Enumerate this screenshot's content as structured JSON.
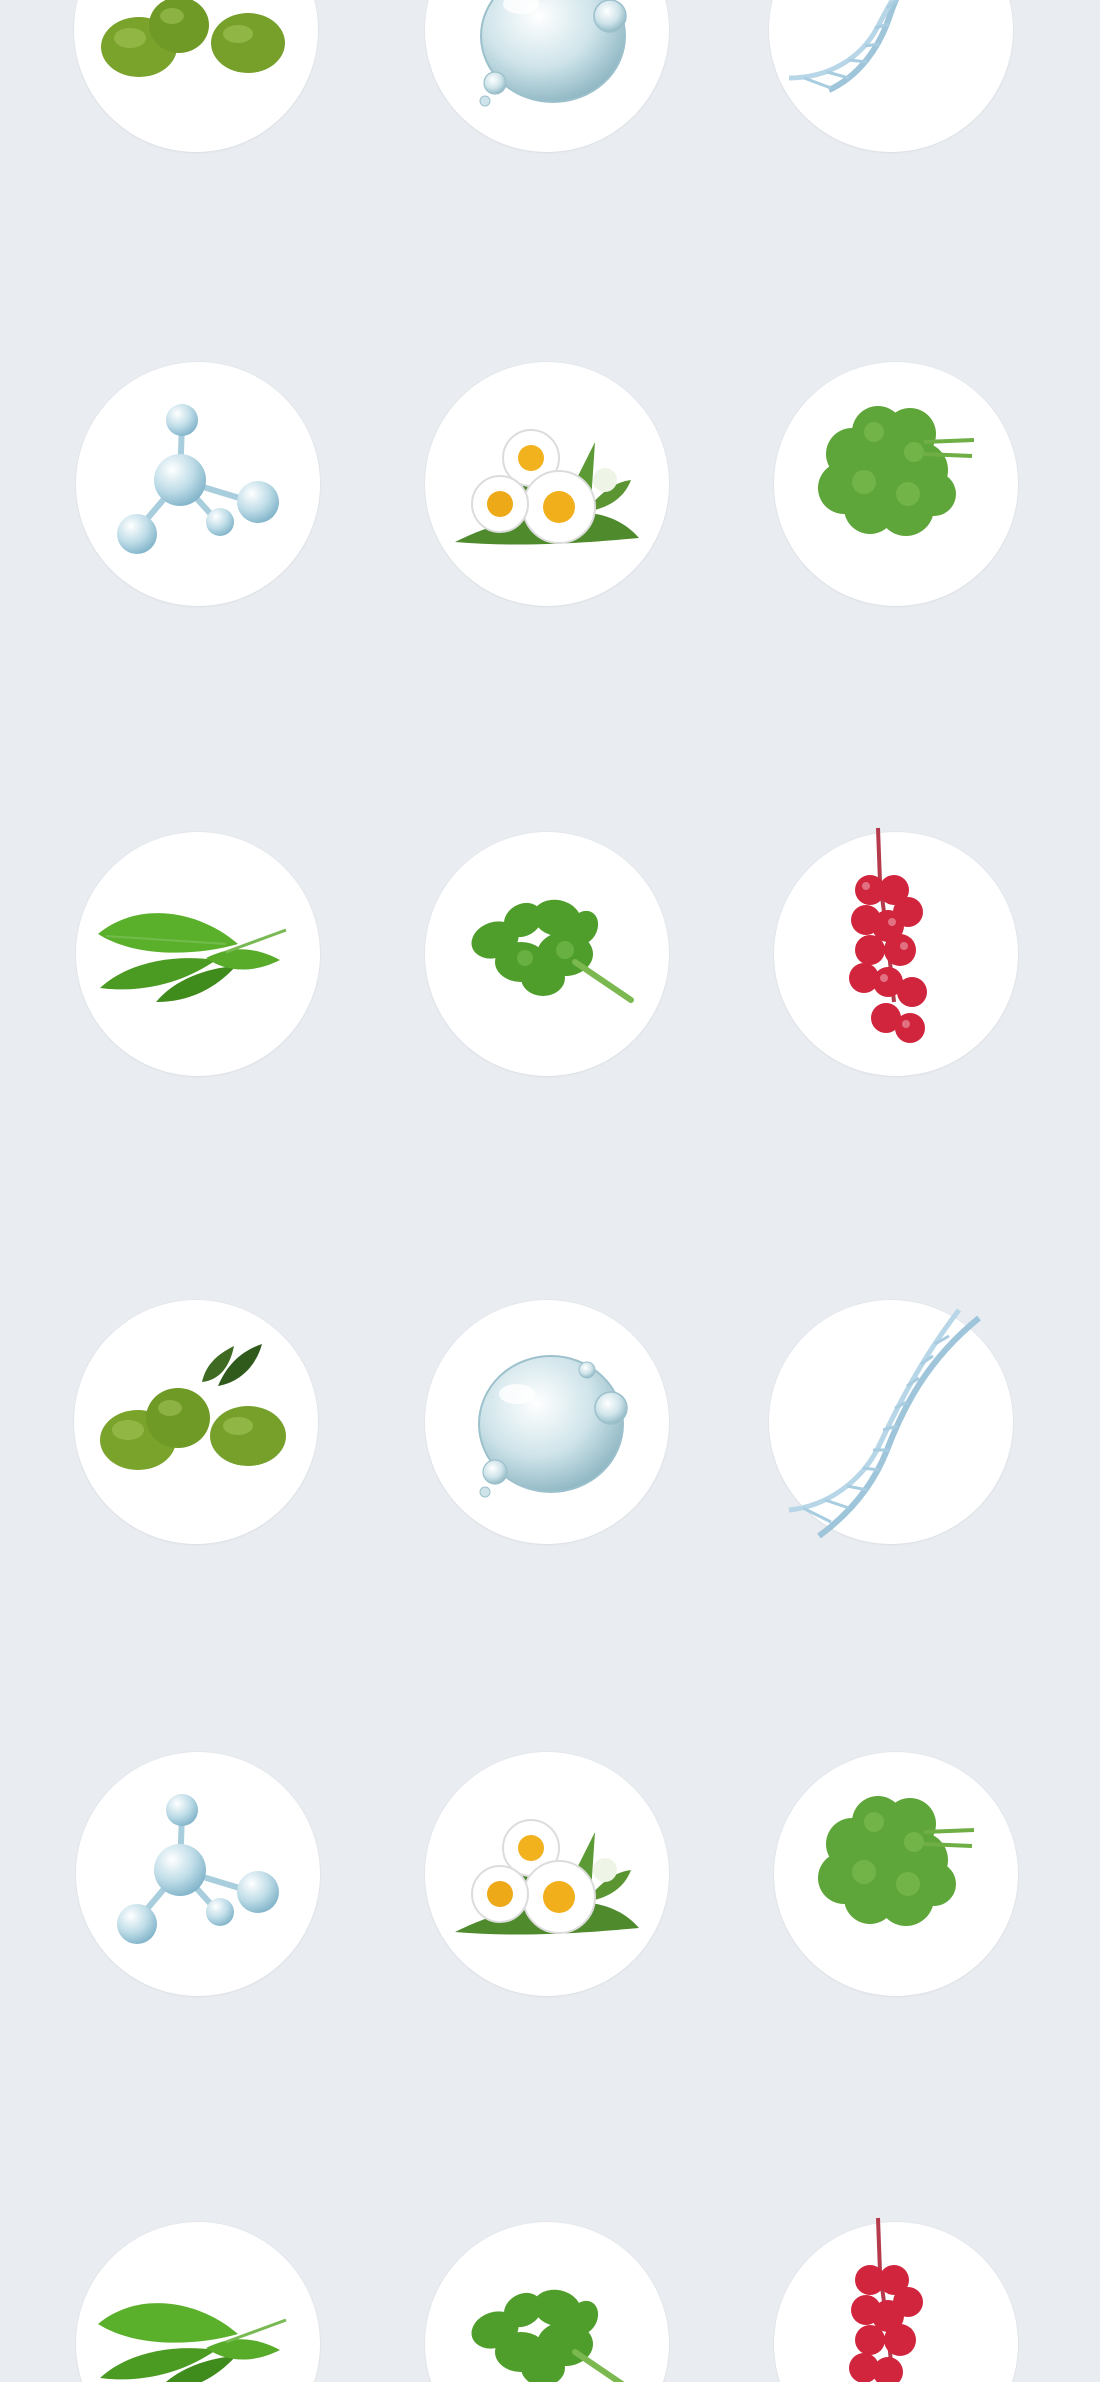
{
  "screen": {
    "background_color": "#e9ecf1",
    "tile_color": "#ffffff"
  },
  "ingredient_grid": {
    "rows": [
      [
        "olive-icon",
        "water-drop-icon",
        "dna-icon"
      ],
      [
        "molecule-icon",
        "chamomile-icon",
        "centella-icon"
      ],
      [
        "tea-leaf-icon",
        "purslane-icon",
        "schisandra-berry-icon"
      ],
      [
        "olive-icon",
        "water-drop-icon",
        "dna-icon"
      ],
      [
        "molecule-icon",
        "chamomile-icon",
        "centella-icon"
      ],
      [
        "tea-leaf-icon",
        "purslane-icon",
        "schisandra-berry-icon"
      ]
    ]
  }
}
